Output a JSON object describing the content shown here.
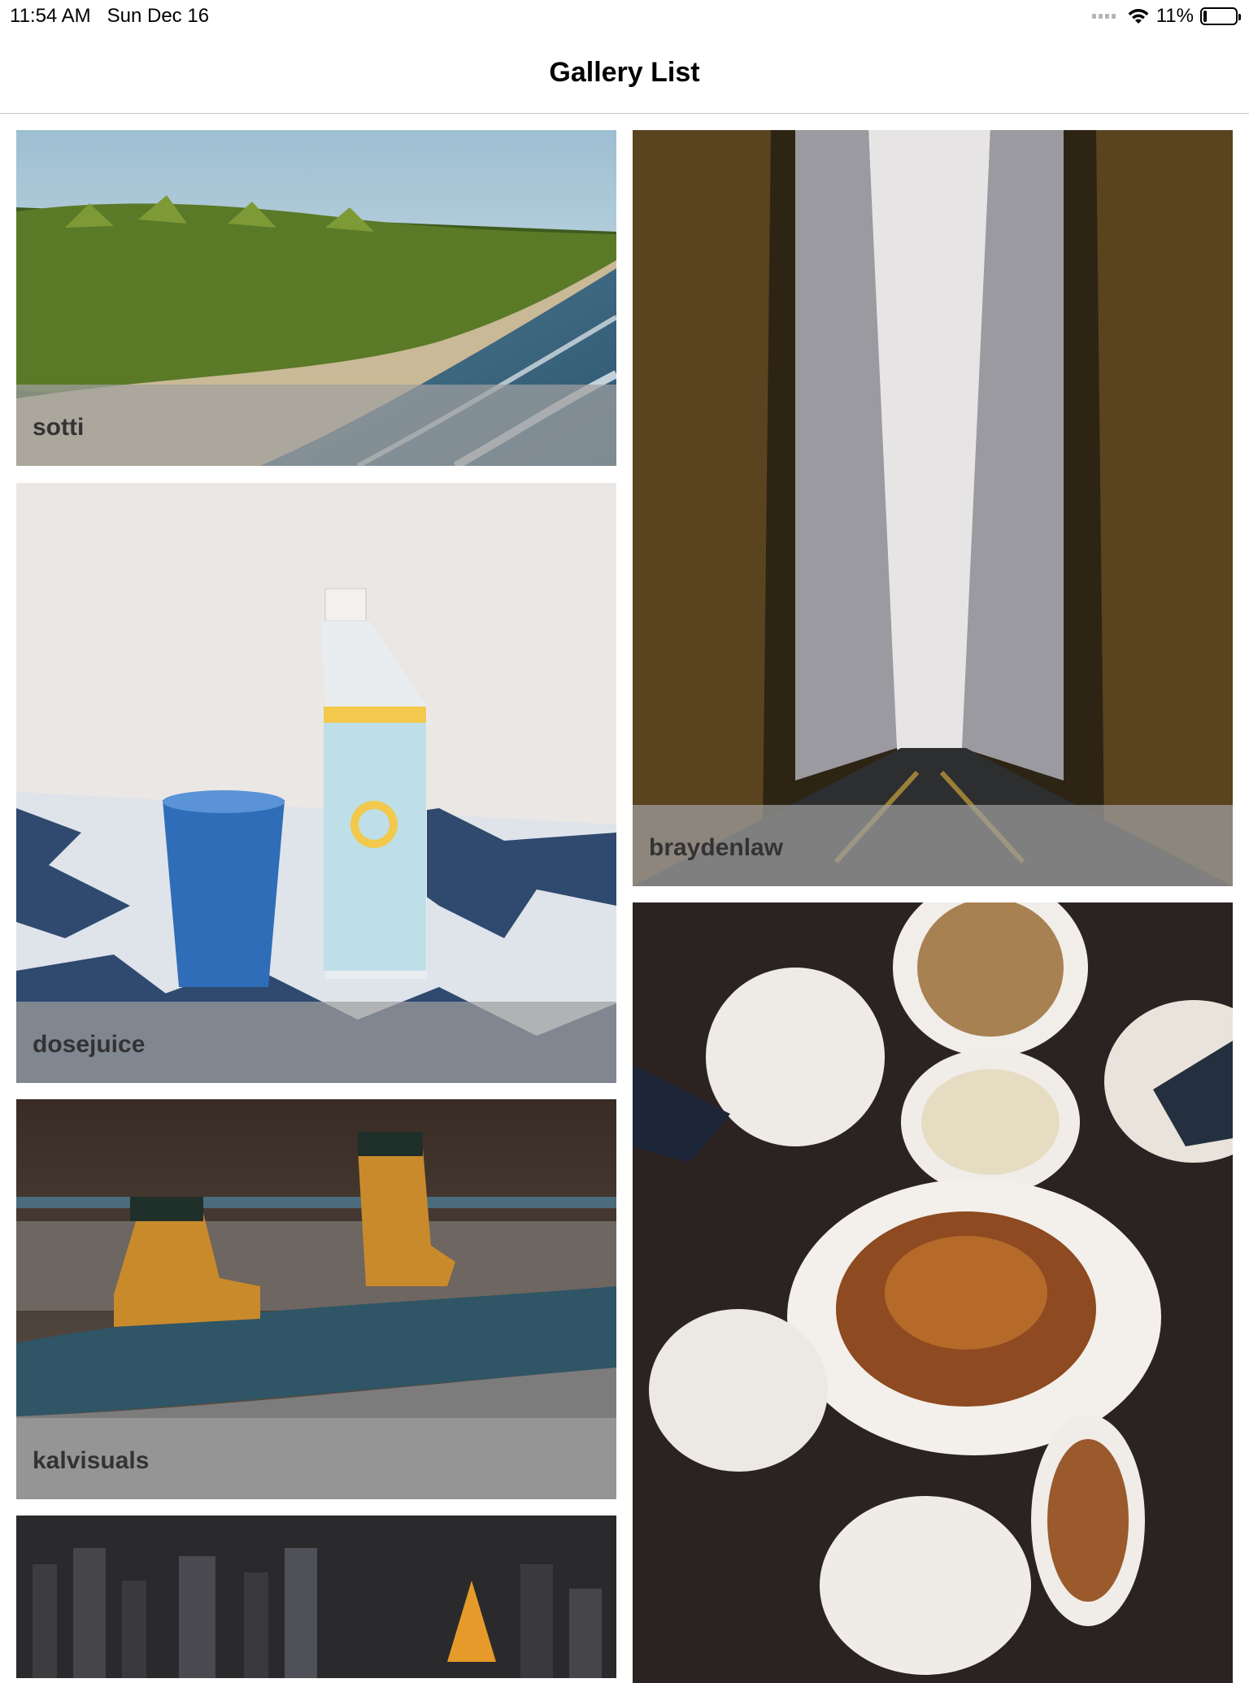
{
  "status_bar": {
    "time": "11:54 AM",
    "date": "Sun Dec 16",
    "battery": "11%",
    "battery_level": 0.11
  },
  "nav": {
    "title": "Gallery List"
  },
  "gallery": {
    "items": [
      {
        "label": "sotti",
        "scene": "tropical beach with palm trees"
      },
      {
        "label": "dosejuice",
        "scene": "blue glass and juice bottle"
      },
      {
        "label": "kalvisuals",
        "scene": "yellow boots on rail track"
      },
      {
        "label": "",
        "scene": "aerial city at night"
      },
      {
        "label": "braydenlaw",
        "scene": "tall buildings street view"
      },
      {
        "label": "",
        "scene": "dinner table with roast turkey"
      }
    ]
  }
}
